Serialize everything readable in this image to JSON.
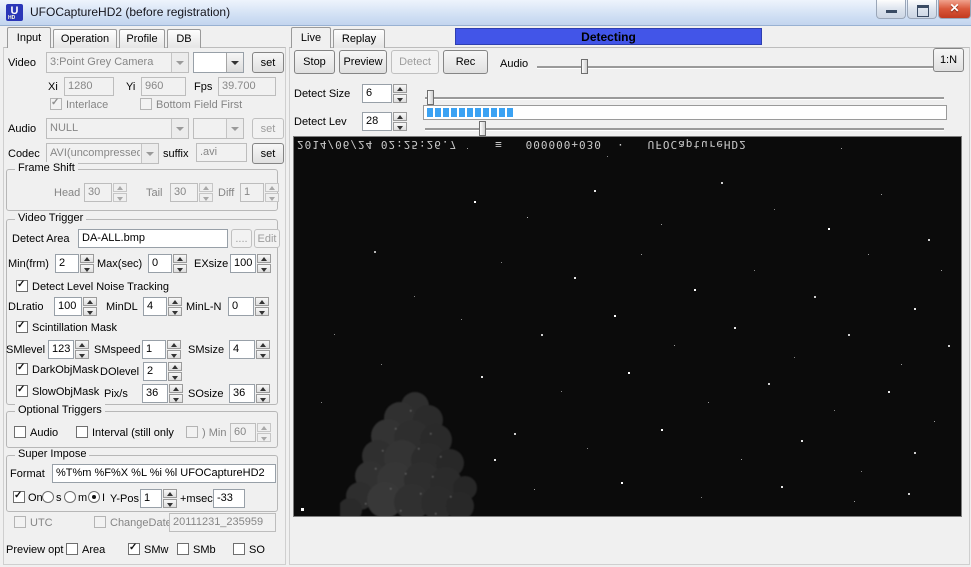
{
  "window": {
    "title": "UFOCaptureHD2 (before registration)",
    "icon_letter": "U",
    "icon_sub": "HD"
  },
  "left": {
    "tabs": {
      "input": "Input",
      "operation": "Operation",
      "profile": "Profile",
      "db": "DB"
    },
    "video": {
      "label": "Video",
      "device": "3:Point Grey Camera",
      "device2": "",
      "set": "set",
      "xi_label": "Xi",
      "xi": "1280",
      "yi_label": "Yi",
      "yi": "960",
      "fps_label": "Fps",
      "fps": "39.700",
      "interlace": "Interlace",
      "bff": "Bottom Field First"
    },
    "audio": {
      "label": "Audio",
      "device": "NULL",
      "device2": "",
      "set": "set"
    },
    "codec": {
      "label": "Codec",
      "value": "AVI(uncompressed",
      "suffix_label": "suffix",
      "suffix": ".avi",
      "set": "set"
    },
    "frame_shift": {
      "title": "Frame Shift",
      "head_label": "Head",
      "head": "30",
      "tail_label": "Tail",
      "tail": "30",
      "diff_label": "Diff",
      "diff": "1"
    },
    "video_trigger": {
      "title": "Video Trigger",
      "detect_area_label": "Detect Area",
      "detect_area": "DA-ALL.bmp",
      "browse": "....",
      "edit": "Edit",
      "min_frm_label": "Min(frm)",
      "min_frm": "2",
      "max_sec_label": "Max(sec)",
      "max_sec": "0",
      "exsize_label": "EXsize",
      "exsize": "100",
      "noise_tracking": "Detect Level Noise Tracking",
      "dlratio_label": "DLratio",
      "dlratio": "100",
      "mindl_label": "MinDL",
      "mindl": "4",
      "minln_label": "MinL-N",
      "minln": "0",
      "scintillation": "Scintillation Mask",
      "smlevel_label": "SMlevel",
      "smlevel": "123",
      "smspeed_label": "SMspeed",
      "smspeed": "1",
      "smsize_label": "SMsize",
      "smsize": "4",
      "dark_obj": "DarkObjMask",
      "dolevel_label": "DOlevel",
      "dolevel": "2",
      "slow_obj": "SlowObjMask",
      "pixs_label": "Pix/s",
      "pixs": "36",
      "sosize_label": "SOsize",
      "sosize": "36"
    },
    "optional": {
      "title": "Optional Triggers",
      "audio": "Audio",
      "interval": "Interval (still only",
      "min_label": ") Min",
      "min": "60"
    },
    "super_impose": {
      "title": "Super Impose",
      "format_label": "Format",
      "format": "%T%m %F%X %L %i %l UFOCaptureHD2",
      "on": "On",
      "s": "s",
      "m": "m",
      "i": "I",
      "ypos_label": "Y-Pos",
      "ypos": "1",
      "msec_label": "+msec",
      "msec": "-33",
      "utc": "UTC",
      "changedate": "ChangeDate",
      "changedate_value": "20111231_235959"
    },
    "preview": {
      "label": "Preview opt",
      "area": "Area",
      "smw": "SMw",
      "smb": "SMb",
      "so": "SO"
    }
  },
  "right": {
    "tabs": {
      "live": "Live",
      "replay": "Replay"
    },
    "status": "Detecting",
    "buttons": {
      "stop": "Stop",
      "preview": "Preview",
      "detect": "Detect",
      "rec": "Rec"
    },
    "audio_label": "Audio",
    "ratio_button": "1:N",
    "detect_size_label": "Detect Size",
    "detect_size": "6",
    "detect_lev_label": "Detect Lev",
    "detect_lev": "28",
    "meter_segments": 11
  },
  "video": {
    "overlay": "2014/06/24 02:25:26.7     ≡   000000+030  ·   UFOCaptureHD2",
    "stars": [
      [
        27,
        17,
        2,
        1
      ],
      [
        35,
        21,
        1,
        0.7
      ],
      [
        45,
        14,
        2,
        0.9
      ],
      [
        55,
        23,
        1,
        0.6
      ],
      [
        64,
        12,
        2,
        0.8
      ],
      [
        72,
        19,
        1,
        0.5
      ],
      [
        80,
        24,
        2,
        1
      ],
      [
        88,
        15,
        1,
        0.6
      ],
      [
        95,
        27,
        2,
        0.8
      ],
      [
        31,
        33,
        1,
        0.5
      ],
      [
        42,
        37,
        2,
        0.9
      ],
      [
        52,
        31,
        1,
        0.6
      ],
      [
        60,
        40,
        2,
        1
      ],
      [
        69,
        35,
        1,
        0.5
      ],
      [
        78,
        42,
        2,
        0.8
      ],
      [
        86,
        31,
        1,
        0.6
      ],
      [
        93,
        45,
        2,
        0.9
      ],
      [
        25,
        48,
        1,
        0.5
      ],
      [
        37,
        52,
        2,
        0.8
      ],
      [
        48,
        47,
        2,
        1
      ],
      [
        57,
        55,
        1,
        0.6
      ],
      [
        66,
        50,
        2,
        0.9
      ],
      [
        75,
        58,
        1,
        0.5
      ],
      [
        83,
        52,
        2,
        0.8
      ],
      [
        91,
        60,
        1,
        0.6
      ],
      [
        28,
        63,
        2,
        0.9
      ],
      [
        40,
        67,
        1,
        0.5
      ],
      [
        50,
        62,
        2,
        1
      ],
      [
        62,
        70,
        1,
        0.6
      ],
      [
        71,
        65,
        2,
        0.8
      ],
      [
        81,
        72,
        1,
        0.5
      ],
      [
        89,
        67,
        2,
        0.9
      ],
      [
        96,
        75,
        1,
        0.6
      ],
      [
        33,
        78,
        2,
        0.8
      ],
      [
        44,
        82,
        1,
        0.5
      ],
      [
        55,
        77,
        2,
        1
      ],
      [
        67,
        85,
        1,
        0.6
      ],
      [
        76,
        80,
        2,
        0.9
      ],
      [
        85,
        88,
        1,
        0.5
      ],
      [
        93,
        83,
        2,
        0.8
      ],
      [
        24,
        90,
        2,
        0.9
      ],
      [
        36,
        93,
        1,
        0.6
      ],
      [
        49,
        91,
        2,
        1
      ],
      [
        61,
        95,
        1,
        0.5
      ],
      [
        73,
        92,
        2,
        0.9
      ],
      [
        84,
        96,
        1,
        0.6
      ],
      [
        92,
        94,
        2,
        0.8
      ],
      [
        13,
        60,
        1,
        0.5
      ],
      [
        15,
        75,
        2,
        0.7
      ],
      [
        10,
        88,
        1,
        0.6
      ],
      [
        8,
        97,
        2,
        0.9
      ],
      [
        18,
        42,
        1,
        0.5
      ],
      [
        12,
        30,
        2,
        0.7
      ],
      [
        6,
        52,
        1,
        0.5
      ],
      [
        97,
        35,
        1,
        0.6
      ],
      [
        98,
        55,
        2,
        0.8
      ],
      [
        4,
        70,
        1,
        0.5
      ],
      [
        1,
        98,
        3,
        1
      ],
      [
        30,
        85,
        2,
        0.9
      ],
      [
        26,
        3,
        1,
        0.6
      ],
      [
        58,
        2,
        1,
        0.5
      ],
      [
        82,
        3,
        1,
        0.6
      ],
      [
        47,
        5,
        1,
        0.5
      ]
    ]
  },
  "colors": {
    "status_bg": "#4255e8",
    "meter_fill": "#3ba2f3",
    "video_bg": "#0b0b0b"
  }
}
